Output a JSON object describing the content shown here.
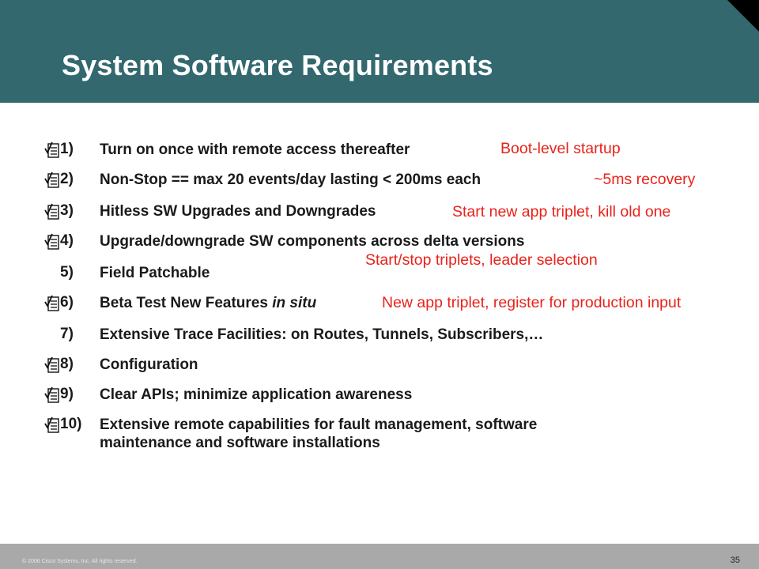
{
  "slide": {
    "title": "System Software Requirements",
    "items": [
      {
        "number": "1)",
        "text": "Turn on once with remote access thereafter",
        "checked": true
      },
      {
        "number": "2)",
        "text": "Non-Stop == max 20 events/day lasting < 200ms each",
        "checked": true
      },
      {
        "number": "3)",
        "text": "Hitless SW Upgrades and Downgrades",
        "checked": true
      },
      {
        "number": "4)",
        "text": "Upgrade/downgrade SW components across delta versions",
        "checked": true
      },
      {
        "number": "5)",
        "text": "Field Patchable",
        "checked": false
      },
      {
        "number": "6)",
        "text": "Beta Test New Features ",
        "text_italic": "in situ",
        "checked": true
      },
      {
        "number": "7)",
        "text": "Extensive Trace Facilities: on Routes, Tunnels, Subscribers,…",
        "checked": false
      },
      {
        "number": "8)",
        "text": "Configuration",
        "checked": true
      },
      {
        "number": "9)",
        "text": "Clear APIs; minimize application awareness",
        "checked": true
      },
      {
        "number": "10)",
        "text": "Extensive remote capabilities for fault management, software",
        "text_line2": "maintenance and software installations",
        "checked": true
      }
    ],
    "notes": {
      "boot": "Boot-level startup",
      "recovery": "~5ms recovery",
      "triplet_start": "Start new app triplet, kill old one",
      "triplet_leader": "Start/stop triplets, leader selection",
      "triplet_register": "New app triplet, register for production input"
    },
    "footer": {
      "copyright": "© 2006 Cisco Systems, Inc. All rights reserved.",
      "page_number": "35"
    },
    "colors": {
      "header": "#33686f",
      "note_text": "#e8231b",
      "body_text": "#1a1a1a",
      "footer": "#a9a9a9"
    },
    "icons": {
      "checkbox": "checkbox-checked-icon"
    }
  }
}
